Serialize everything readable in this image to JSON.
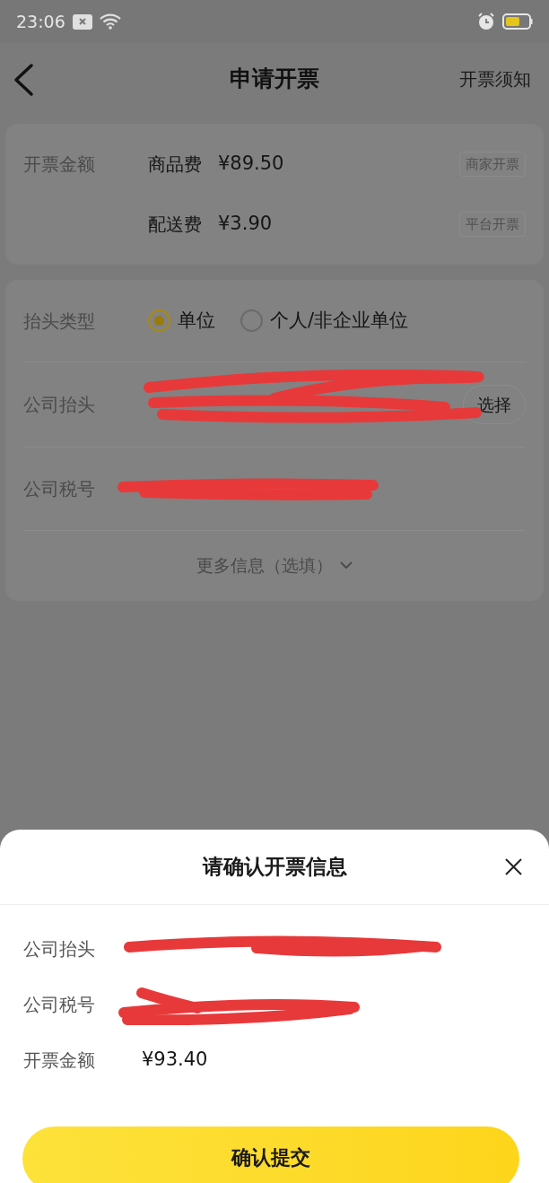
{
  "status_bar": {
    "time": "23:06"
  },
  "nav": {
    "title": "申请开票",
    "action": "开票须知"
  },
  "amount_card": {
    "label": "开票金额",
    "items": [
      {
        "name": "商品费",
        "amount": "¥89.50",
        "tag": "商家开票"
      },
      {
        "name": "配送费",
        "amount": "¥3.90",
        "tag": "平台开票"
      }
    ]
  },
  "form": {
    "title_type": {
      "label": "抬头类型",
      "options": [
        {
          "label": "单位",
          "selected": true
        },
        {
          "label": "个人/非企业单位",
          "selected": false
        }
      ]
    },
    "company_title": {
      "label": "公司抬头",
      "button": "选择"
    },
    "tax_number": {
      "label": "公司税号"
    },
    "more": "更多信息（选填）"
  },
  "sheet": {
    "title": "请确认开票信息",
    "rows": [
      {
        "label": "公司抬头"
      },
      {
        "label": "公司税号"
      },
      {
        "label": "开票金额",
        "value": "¥93.40"
      }
    ],
    "submit": "确认提交"
  }
}
